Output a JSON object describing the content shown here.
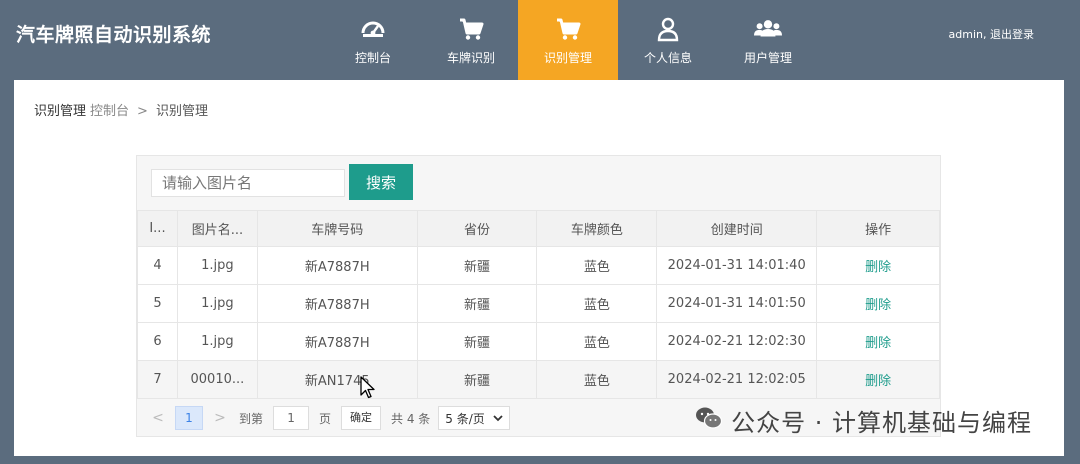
{
  "app": {
    "title": "汽车牌照自动识别系统"
  },
  "nav": {
    "items": [
      {
        "label": "控制台",
        "icon": "dashboard-icon"
      },
      {
        "label": "车牌识别",
        "icon": "cart-icon"
      },
      {
        "label": "识别管理",
        "icon": "cart-icon",
        "active": true
      },
      {
        "label": "个人信息",
        "icon": "user-icon"
      },
      {
        "label": "用户管理",
        "icon": "users-icon"
      }
    ]
  },
  "user": {
    "status": "admin, 退出登录"
  },
  "breadcrumb": {
    "current": "识别管理",
    "home": "控制台",
    "separator": ">",
    "page": "识别管理"
  },
  "search": {
    "placeholder": "请输入图片名",
    "button": "搜索"
  },
  "table": {
    "headers": [
      "I...",
      "图片名...",
      "车牌号码",
      "省份",
      "车牌颜色",
      "创建时间",
      "操作"
    ],
    "rows": [
      {
        "id": "4",
        "image": "1.jpg",
        "plate": "新A7887H",
        "province": "新疆",
        "color": "蓝色",
        "created": "2024-01-31 14:01:40",
        "action": "删除"
      },
      {
        "id": "5",
        "image": "1.jpg",
        "plate": "新A7887H",
        "province": "新疆",
        "color": "蓝色",
        "created": "2024-01-31 14:01:50",
        "action": "删除"
      },
      {
        "id": "6",
        "image": "1.jpg",
        "plate": "新A7887H",
        "province": "新疆",
        "color": "蓝色",
        "created": "2024-02-21 12:02:30",
        "action": "删除"
      },
      {
        "id": "7",
        "image": "00010...",
        "plate": "新AN1745",
        "province": "新疆",
        "color": "蓝色",
        "created": "2024-02-21 12:02:05",
        "action": "删除"
      }
    ]
  },
  "pagination": {
    "prev": "<",
    "current": "1",
    "next": ">",
    "goto_label": "到第",
    "goto_value": "1",
    "page_label": "页",
    "confirm": "确定",
    "total": "共 4 条",
    "page_size": "5 条/页"
  },
  "watermark": "公众号 · 计算机基础与编程",
  "colors": {
    "header": "#5b6c7e",
    "active_nav": "#f5a623",
    "primary": "#1e9c8c",
    "page_active": "#dbe8fb"
  }
}
